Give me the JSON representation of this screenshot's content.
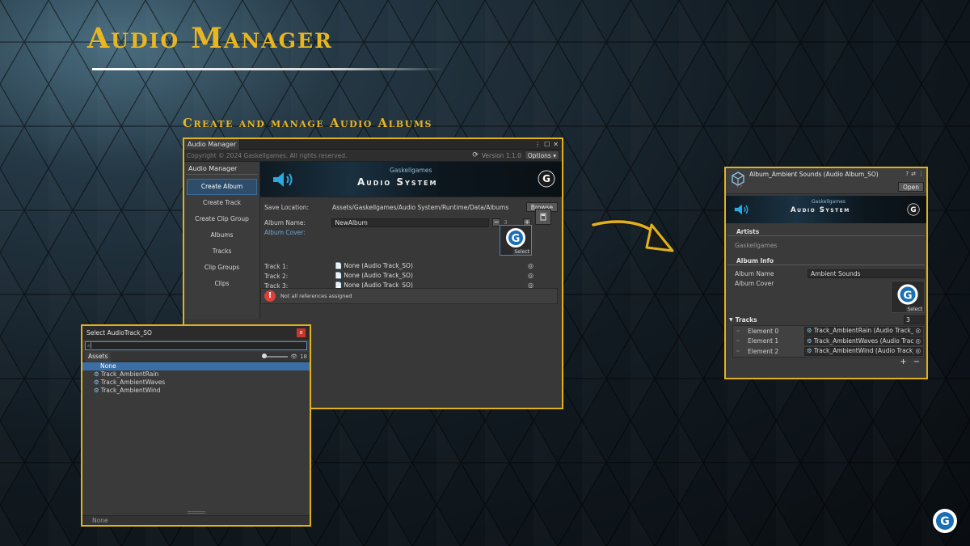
{
  "page": {
    "headline": "Audio Manager",
    "subheadline": "Create and manage Audio Albums"
  },
  "manager": {
    "window_tab": "Audio Manager",
    "copyright": "Copyright © 2024 Gaskellgames. All rights reserved.",
    "version": "Version 1.1.0",
    "options_label": "Options ▾",
    "sidebar_title": "Audio Manager",
    "nav": [
      "Create Album",
      "Create Track",
      "Create Clip Group",
      "Albums",
      "Tracks",
      "Clip Groups",
      "Clips"
    ],
    "banner_brand": "Gaskellgames",
    "banner_title": "Audio System",
    "save_location_label": "Save Location:",
    "save_location_value": "Assets/Gaskellgames/Audio System/Runtime/Data/Albums",
    "browse_label": "Browse",
    "album_name_label": "Album Name:",
    "album_name_value": "NewAlbum",
    "track_count": "3",
    "album_cover_label": "Album Cover:",
    "cover_select": "Select",
    "tracks": [
      {
        "label": "Track 1:",
        "value": "None (Audio Track_SO)"
      },
      {
        "label": "Track 2:",
        "value": "None (Audio Track_SO)"
      },
      {
        "label": "Track 3:",
        "value": "None (Audio Track_SO)"
      }
    ],
    "warning": "Not all references assigned"
  },
  "selector": {
    "title": "Select AudioTrack_SO",
    "close": "x",
    "search_value": "",
    "tab_assets": "Assets",
    "count": "18",
    "items": [
      "None",
      "Track_AmbientRain",
      "Track_AmbientWaves",
      "Track_AmbientWind"
    ],
    "footer": "None"
  },
  "inspector": {
    "title": "Album_Ambient Sounds (Audio Album_SO)",
    "open_label": "Open",
    "banner_brand": "Gaskellgames",
    "banner_title": "Audio System",
    "artists_title": "Artists",
    "artists_value": "Gaskellgames",
    "album_info_title": "Album Info",
    "album_name_label": "Album Name",
    "album_name_value": "Ambient Sounds",
    "album_cover_label": "Album Cover",
    "cover_select": "Select",
    "tracks_title": "Tracks",
    "tracks_count": "3",
    "elements": [
      {
        "label": "Element 0",
        "value": "Track_AmbientRain (Audio Track_"
      },
      {
        "label": "Element 1",
        "value": "Track_AmbientWaves (Audio Trac"
      },
      {
        "label": "Element 2",
        "value": "Track_AmbientWind (Audio Track_"
      }
    ],
    "add": "+",
    "remove": "−"
  },
  "colors": {
    "accent": "#e2b21e",
    "selection": "#3a6ea5",
    "error": "#d9413a"
  },
  "icons": {
    "speaker": "speaker-icon",
    "logo": "gaskellgames-logo",
    "arrow": "curved-arrow-icon"
  }
}
